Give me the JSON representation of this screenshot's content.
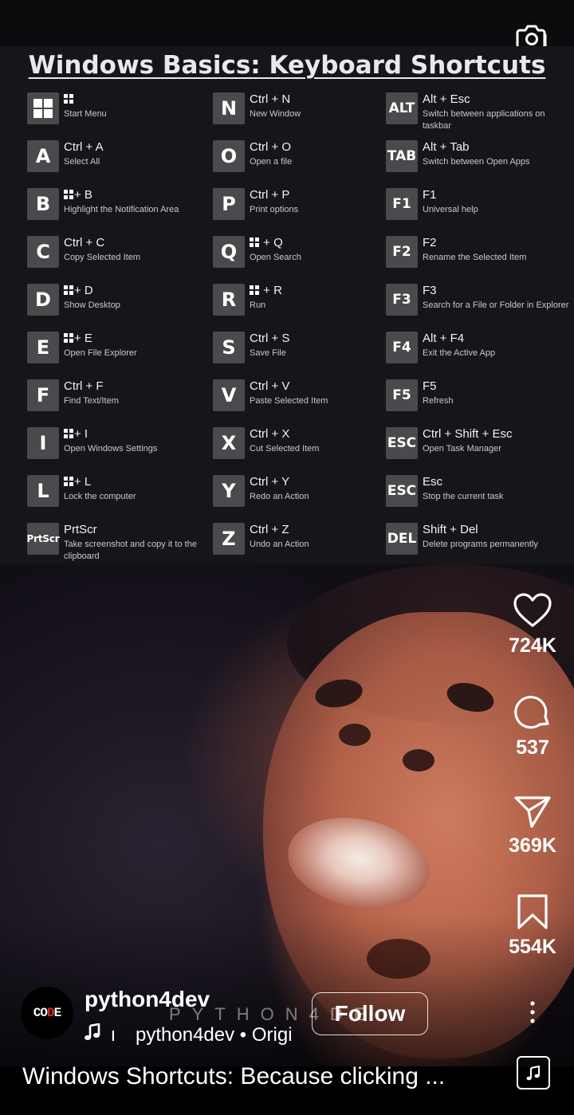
{
  "sheet": {
    "title": "Windows Basics: Keyboard Shortcuts",
    "columns": [
      [
        {
          "key": "win",
          "combo": "",
          "desc": "Start Menu",
          "combo_win": true
        },
        {
          "key": "A",
          "combo": "Ctrl + A",
          "desc": "Select All"
        },
        {
          "key": "B",
          "combo": "+ B",
          "desc": "Highlight the Notification Area",
          "combo_win": true
        },
        {
          "key": "C",
          "combo": "Ctrl + C",
          "desc": "Copy Selected Item"
        },
        {
          "key": "D",
          "combo": "+ D",
          "desc": "Show Desktop",
          "combo_win": true
        },
        {
          "key": "E",
          "combo": "+ E",
          "desc": "Open File Explorer",
          "combo_win": true
        },
        {
          "key": "F",
          "combo": "Ctrl + F",
          "desc": "Find Text/Item"
        },
        {
          "key": "I",
          "combo": "+ I",
          "desc": "Open Windows Settings",
          "combo_win": true
        },
        {
          "key": "L",
          "combo": "+ L",
          "desc": "Lock the computer",
          "combo_win": true
        },
        {
          "key": "PrtScr",
          "combo": "PrtScr",
          "desc": "Take screenshot and copy it to the clipboard"
        }
      ],
      [
        {
          "key": "N",
          "combo": "Ctrl + N",
          "desc": "New Window"
        },
        {
          "key": "O",
          "combo": "Ctrl + O",
          "desc": "Open a file"
        },
        {
          "key": "P",
          "combo": "Ctrl  + P",
          "desc": "Print options"
        },
        {
          "key": "Q",
          "combo": " + Q",
          "desc": "Open Search",
          "combo_win": true
        },
        {
          "key": "R",
          "combo": " + R",
          "desc": "Run",
          "combo_win": true
        },
        {
          "key": "S",
          "combo": "Ctrl + S",
          "desc": "Save File"
        },
        {
          "key": "V",
          "combo": "Ctrl + V",
          "desc": "Paste Selected Item"
        },
        {
          "key": "X",
          "combo": "Ctrl + X",
          "desc": "Cut Selected Item"
        },
        {
          "key": "Y",
          "combo": "Ctrl + Y",
          "desc": "Redo an Action"
        },
        {
          "key": "Z",
          "combo": "Ctrl + Z",
          "desc": "Undo an Action"
        }
      ],
      [
        {
          "key": "ALT",
          "combo": "Alt + Esc",
          "desc": "Switch between applications on taskbar"
        },
        {
          "key": "TAB",
          "combo": "Alt + Tab",
          "desc": "Switch between Open Apps"
        },
        {
          "key": "F1",
          "combo": "F1",
          "desc": "Universal help"
        },
        {
          "key": "F2",
          "combo": "F2",
          "desc": "Rename the Selected Item"
        },
        {
          "key": "F3",
          "combo": "F3",
          "desc": "Search for a File or Folder in Explorer"
        },
        {
          "key": "F4",
          "combo": "Alt  + F4",
          "desc": "Exit the Active App"
        },
        {
          "key": "F5",
          "combo": "F5",
          "desc": "Refresh"
        },
        {
          "key": "ESC",
          "combo": "Ctrl + Shift + Esc",
          "desc": "Open Task Manager"
        },
        {
          "key": "ESC",
          "combo": "Esc",
          "desc": "Stop the current task"
        },
        {
          "key": "DEL",
          "combo": "Shift + Del",
          "desc": "Delete programs permanently"
        }
      ]
    ]
  },
  "actions": {
    "likes": "724K",
    "comments": "537",
    "shares": "369K",
    "saves": "554K"
  },
  "author": {
    "avatar_text_a": "CO",
    "avatar_text_b": "D",
    "avatar_text_c": "E",
    "username": "python4dev",
    "watermark": "PYTHON4DE",
    "follow_label": "Follow",
    "audio": "python4dev • Origi",
    "audio_sep": "ı"
  },
  "caption": "Windows Shortcuts: Because clicking ...",
  "colors": {
    "sheet_bg": "#15161a",
    "key_bg": "#4a4a4c",
    "brand_red": "#e02424"
  },
  "icons": [
    "camera-icon",
    "heart-icon",
    "comment-icon",
    "send-icon",
    "bookmark-icon",
    "music-note-icon",
    "more-icon",
    "audio-thumb-icon"
  ]
}
